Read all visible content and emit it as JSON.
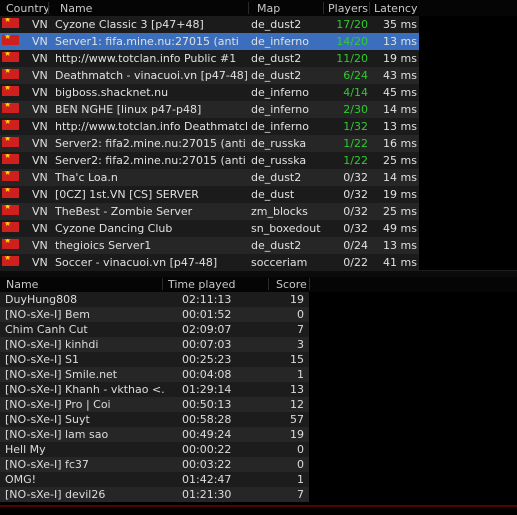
{
  "server_columns": {
    "country": "Country",
    "name": "Name",
    "map": "Map",
    "players": "Players",
    "latency": "Latency"
  },
  "servers": [
    {
      "country": "VN",
      "name": "Cyzone Classic 3 [p47+48]",
      "map": "de_dust2",
      "players": "17/20",
      "latency": "35 ms",
      "green": true
    },
    {
      "country": "VN",
      "name": "Server1: fifa.mine.nu:27015 (anti",
      "map": "de_inferno",
      "players": "14/20",
      "latency": "13 ms",
      "green": true,
      "selected": true
    },
    {
      "country": "VN",
      "name": "http://www.totclan.info Public #1",
      "map": "de_dust2",
      "players": "11/20",
      "latency": "19 ms",
      "green": true
    },
    {
      "country": "VN",
      "name": "Deathmatch - vinacuoi.vn [p47-48]",
      "map": "de_dust2",
      "players": "6/24",
      "latency": "43 ms",
      "green": true
    },
    {
      "country": "VN",
      "name": "bigboss.shacknet.nu",
      "map": "de_inferno",
      "players": "4/14",
      "latency": "45 ms",
      "green": true
    },
    {
      "country": "VN",
      "name": "BEN NGHE [linux p47-p48]",
      "map": "de_inferno",
      "players": "2/30",
      "latency": "14 ms",
      "green": true
    },
    {
      "country": "VN",
      "name": "http://www.totclan.info Deathmatch",
      "map": "de_inferno",
      "players": "1/32",
      "latency": "13 ms",
      "green": true
    },
    {
      "country": "VN",
      "name": "Server2: fifa2.mine.nu:27015 (anti",
      "map": "de_russka",
      "players": "1/22",
      "latency": "16 ms",
      "green": true
    },
    {
      "country": "VN",
      "name": "Server2: fifa2.mine.nu:27015 (anti",
      "map": "de_russka",
      "players": "1/22",
      "latency": "25 ms",
      "green": true
    },
    {
      "country": "VN",
      "name": "Tha'c Loa.n",
      "map": "de_dust2",
      "players": "0/32",
      "latency": "14 ms",
      "green": false
    },
    {
      "country": "VN",
      "name": "[0CZ] 1st.VN [CS] SERVER",
      "map": "de_dust",
      "players": "0/32",
      "latency": "19 ms",
      "green": false
    },
    {
      "country": "VN",
      "name": "TheBest - Zombie Server",
      "map": "zm_blocks",
      "players": "0/32",
      "latency": "25 ms",
      "green": false
    },
    {
      "country": "VN",
      "name": "Cyzone Dancing Club",
      "map": "sn_boxedout",
      "players": "0/32",
      "latency": "49 ms",
      "green": false
    },
    {
      "country": "VN",
      "name": "thegioics Server1",
      "map": "de_dust2",
      "players": "0/24",
      "latency": "13 ms",
      "green": false
    },
    {
      "country": "VN",
      "name": "Soccer - vinacuoi.vn [p47-48]",
      "map": "socceriam",
      "players": "0/22",
      "latency": "41 ms",
      "green": false
    }
  ],
  "player_columns": {
    "name": "Name",
    "time": "Time played",
    "score": "Score"
  },
  "players": [
    {
      "name": "DuyHung808",
      "time": "02:11:13",
      "score": "19"
    },
    {
      "name": "[NO-sXe-I] Bem",
      "time": "00:01:52",
      "score": "0"
    },
    {
      "name": "Chim Canh Cut",
      "time": "02:09:07",
      "score": "7"
    },
    {
      "name": "[NO-sXe-I] kinhdi",
      "time": "00:07:03",
      "score": "3"
    },
    {
      "name": "[NO-sXe-I] S1",
      "time": "00:25:23",
      "score": "15"
    },
    {
      "name": "[NO-sXe-I] Smile.net",
      "time": "00:04:08",
      "score": "1"
    },
    {
      "name": "[NO-sXe-I] Khanh - vkthao <...",
      "time": "01:29:14",
      "score": "13"
    },
    {
      "name": "[NO-sXe-I] Pro | Coi",
      "time": "00:50:13",
      "score": "12"
    },
    {
      "name": "[NO-sXe-I] Suyt",
      "time": "00:58:28",
      "score": "57"
    },
    {
      "name": "[NO-sXe-I] lam sao",
      "time": "00:49:24",
      "score": "19"
    },
    {
      "name": "Hell My",
      "time": "00:00:22",
      "score": "0"
    },
    {
      "name": "[NO-sXe-I] fc37",
      "time": "00:03:22",
      "score": "0"
    },
    {
      "name": "OMG!",
      "time": "01:42:47",
      "score": "1"
    },
    {
      "name": "[NO-sXe-I] devil26",
      "time": "01:21:30",
      "score": "7"
    }
  ]
}
